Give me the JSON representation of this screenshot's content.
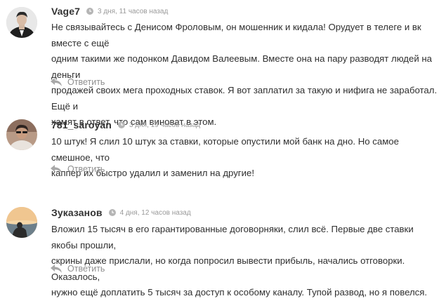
{
  "comments": [
    {
      "username": "Vage7",
      "time": "3 дня, 11 часов назад",
      "lines": [
        "Не связывайтесь с Денисом Фроловым, он мошенник и кидала! Орудует в телеге и вк вместе с ещё",
        "одним такими же подонком Давидом Валеевым. Вместе она на пару разводят людей на деньги",
        "продажей своих мега проходных ставок. Я вот заплатил за такую и нифига не заработал. Ещё и",
        "хамят в ответ, что сам виноват в этом."
      ],
      "reply_label": "Ответить",
      "avatar_icon": "user-avatar-icon"
    },
    {
      "username": "781_saroyan",
      "time": "3 дня, 19 часов назад",
      "lines": [
        "10 штук! Я слил 10 штук за ставки, которые опустили мой банк на дно. Но самое смешное, что",
        "каппер их быстро удалил и заменил на другие!"
      ],
      "reply_label": "Ответить",
      "avatar_icon": "user-avatar-icon"
    },
    {
      "username": "Зуказанов",
      "time": "4 дня, 12 часов назад",
      "lines": [
        "Вложил 15 тысяч в его гарантированные договорняки, слил всё. Первые две ставки якобы прошли,",
        "скрины даже прислали, но когда попросил вывести прибыль, начались отговорки. Оказалось,",
        "нужно ещё доплатить 5 тысяч за доступ к особому каналу. Тупой развод, но я повелся."
      ],
      "reply_label": "Ответить",
      "avatar_icon": "user-avatar-icon"
    }
  ],
  "colors": {
    "text": "#2f2f2f",
    "muted": "#9a9a9a",
    "username": "#333333"
  }
}
